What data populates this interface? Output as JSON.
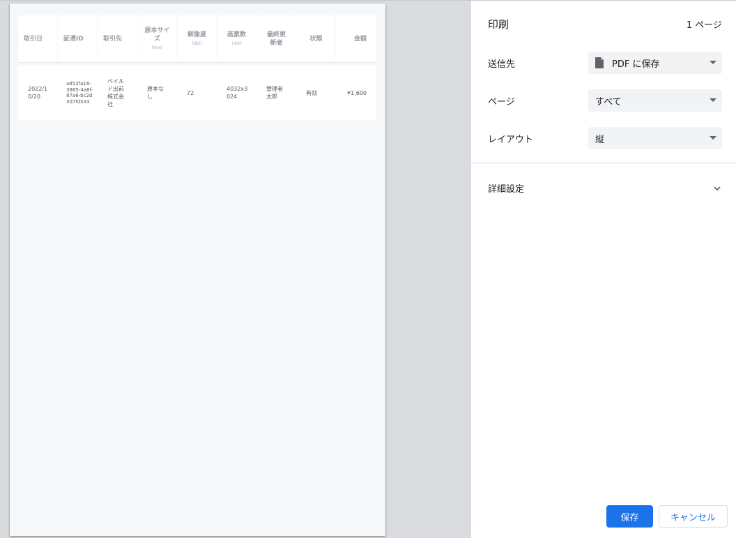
{
  "preview": {
    "table": {
      "headers": [
        {
          "label": "取引日",
          "unit": ""
        },
        {
          "label": "証憑ID",
          "unit": ""
        },
        {
          "label": "取引先",
          "unit": ""
        },
        {
          "label": "原本サイズ",
          "unit": "(mm)"
        },
        {
          "label": "解像度",
          "unit": "(dpi)"
        },
        {
          "label": "画素数",
          "unit": "(dot)"
        },
        {
          "label": "最終更新者",
          "unit": ""
        },
        {
          "label": "状態",
          "unit": ""
        },
        {
          "label": "金額",
          "unit": ""
        }
      ],
      "rows": [
        {
          "date": "2022/10/20",
          "voucher_id": "a852fa16-3885-4a8f-87a6-bc2d3d7fdb33",
          "partner": "ベイルド出前株式会社",
          "original_size": "原本なし",
          "resolution": "72",
          "pixels": "4032x3024",
          "updated_by": "管理者太郎",
          "status": "有効",
          "amount": "¥1,600"
        }
      ]
    }
  },
  "settings": {
    "title": "印刷",
    "page_count": "1 ページ",
    "destination": {
      "label": "送信先",
      "value": "PDF に保存",
      "icon": "document-icon"
    },
    "pages": {
      "label": "ページ",
      "value": "すべて"
    },
    "layout": {
      "label": "レイアウト",
      "value": "縦"
    },
    "more_settings": {
      "label": "詳細設定",
      "icon": "chevron-down-icon"
    },
    "buttons": {
      "save": "保存",
      "cancel": "キャンセル"
    }
  },
  "colors": {
    "accent": "#1a73e8",
    "panel_bg": "#ffffff",
    "preview_bg": "#d9dbde"
  }
}
